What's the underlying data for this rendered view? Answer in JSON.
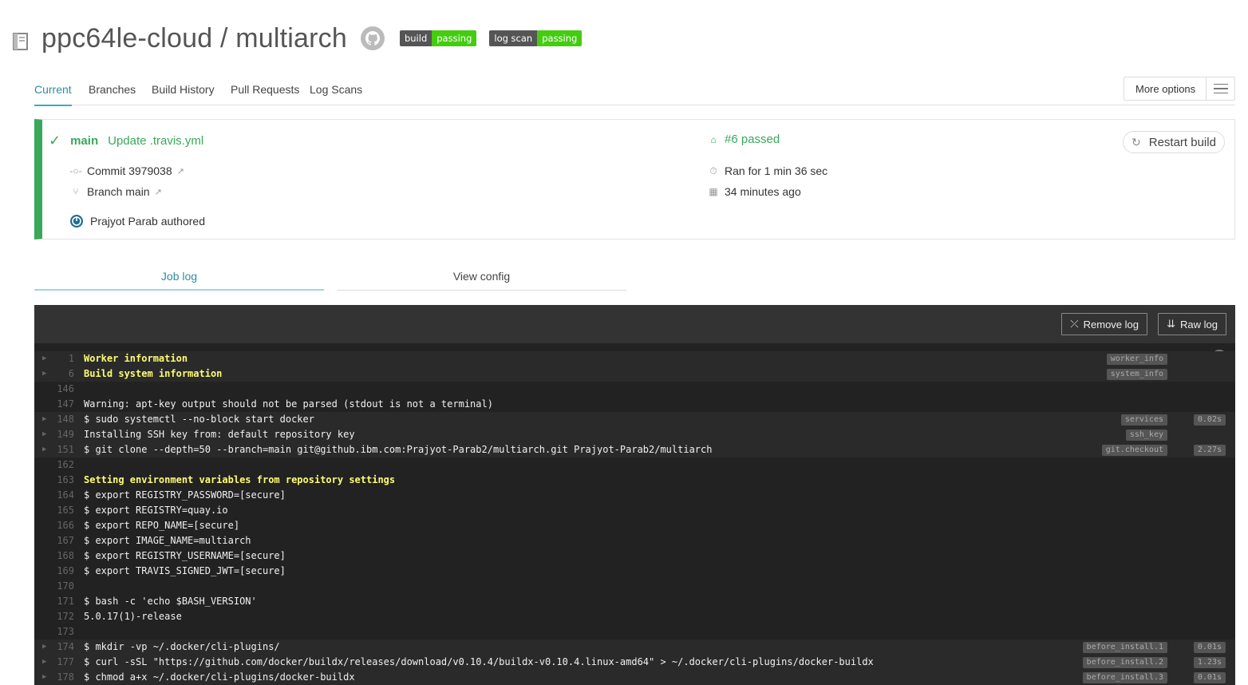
{
  "header": {
    "repo_title": "ppc64le-cloud / multiarch",
    "badges": [
      {
        "label": "build",
        "status": "passing"
      },
      {
        "label": "log scan",
        "status": "passing"
      }
    ]
  },
  "tabs": {
    "items": [
      "Current",
      "Branches",
      "Build History",
      "Pull Requests",
      "Log Scans"
    ],
    "active": "Current",
    "more_options": "More options"
  },
  "build": {
    "branch": "main",
    "commit_message": "Update .travis.yml",
    "commit": "Commit 3979038",
    "branch_link": "Branch main",
    "author": "Prajyot Parab authored",
    "status": "#6 passed",
    "duration": "Ran for 1 min 36 sec",
    "finished": "34 minutes ago",
    "restart_label": "Restart build",
    "status_color": "#39a85b"
  },
  "log_tabs": {
    "job_log": "Job log",
    "view_config": "View config"
  },
  "log": {
    "remove_label": "Remove log",
    "raw_label": "Raw log",
    "lines": [
      {
        "num": "1",
        "text": "Worker information",
        "fold": true,
        "yellow": true,
        "tag": "worker_info",
        "time": ""
      },
      {
        "num": "6",
        "text": "Build system information",
        "fold": true,
        "yellow": true,
        "tag": "system_info",
        "time": ""
      },
      {
        "num": "146",
        "text": "",
        "fold": false,
        "yellow": false,
        "tag": "",
        "time": ""
      },
      {
        "num": "147",
        "text": "Warning: apt-key output should not be parsed (stdout is not a terminal)",
        "fold": false,
        "yellow": false,
        "tag": "",
        "time": ""
      },
      {
        "num": "148",
        "text": "$ sudo systemctl --no-block start docker",
        "fold": true,
        "yellow": false,
        "tag": "services",
        "time": "0.02s"
      },
      {
        "num": "149",
        "text": "Installing SSH key from: default repository key",
        "fold": true,
        "yellow": false,
        "tag": "ssh_key",
        "time": ""
      },
      {
        "num": "151",
        "text": "$ git clone --depth=50 --branch=main git@github.ibm.com:Prajyot-Parab2/multiarch.git Prajyot-Parab2/multiarch",
        "fold": true,
        "yellow": false,
        "tag": "git.checkout",
        "time": "2.27s"
      },
      {
        "num": "162",
        "text": "",
        "fold": false,
        "yellow": false,
        "tag": "",
        "time": ""
      },
      {
        "num": "163",
        "text": "Setting environment variables from repository settings",
        "fold": false,
        "yellow": true,
        "tag": "",
        "time": ""
      },
      {
        "num": "164",
        "text": "$ export REGISTRY_PASSWORD=[secure]",
        "fold": false,
        "yellow": false,
        "tag": "",
        "time": ""
      },
      {
        "num": "165",
        "text": "$ export REGISTRY=quay.io",
        "fold": false,
        "yellow": false,
        "tag": "",
        "time": ""
      },
      {
        "num": "166",
        "text": "$ export REPO_NAME=[secure]",
        "fold": false,
        "yellow": false,
        "tag": "",
        "time": ""
      },
      {
        "num": "167",
        "text": "$ export IMAGE_NAME=multiarch",
        "fold": false,
        "yellow": false,
        "tag": "",
        "time": ""
      },
      {
        "num": "168",
        "text": "$ export REGISTRY_USERNAME=[secure]",
        "fold": false,
        "yellow": false,
        "tag": "",
        "time": ""
      },
      {
        "num": "169",
        "text": "$ export TRAVIS_SIGNED_JWT=[secure]",
        "fold": false,
        "yellow": false,
        "tag": "",
        "time": ""
      },
      {
        "num": "170",
        "text": "",
        "fold": false,
        "yellow": false,
        "tag": "",
        "time": ""
      },
      {
        "num": "171",
        "text": "$ bash -c 'echo $BASH_VERSION'",
        "fold": false,
        "yellow": false,
        "tag": "",
        "time": ""
      },
      {
        "num": "172",
        "text": "5.0.17(1)-release",
        "fold": false,
        "yellow": false,
        "tag": "",
        "time": ""
      },
      {
        "num": "173",
        "text": "",
        "fold": false,
        "yellow": false,
        "tag": "",
        "time": ""
      },
      {
        "num": "174",
        "text": "$ mkdir -vp ~/.docker/cli-plugins/",
        "fold": true,
        "yellow": false,
        "tag": "before_install.1",
        "time": "0.01s"
      },
      {
        "num": "177",
        "text": "$ curl -sSL \"https://github.com/docker/buildx/releases/download/v0.10.4/buildx-v0.10.4.linux-amd64\" > ~/.docker/cli-plugins/docker-buildx",
        "fold": true,
        "yellow": false,
        "tag": "before_install.2",
        "time": "1.23s"
      },
      {
        "num": "178",
        "text": "$ chmod a+x ~/.docker/cli-plugins/docker-buildx",
        "fold": true,
        "yellow": false,
        "tag": "before_install.3",
        "time": "0.01s"
      }
    ]
  }
}
